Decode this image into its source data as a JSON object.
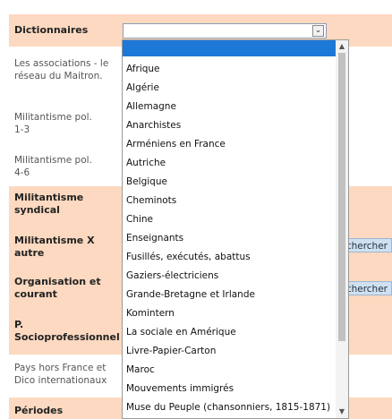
{
  "left_panel": {
    "rows": [
      {
        "label": "Dictionnaires",
        "style": "peach-bold"
      },
      {
        "label": "Les associations - le réseau du Maitron.",
        "style": "light"
      },
      {
        "label": "Militantisme pol. 1-3",
        "style": "light"
      },
      {
        "label": "Militantisme pol. 4-6",
        "style": "light"
      },
      {
        "label": "Militantisme syndical",
        "style": "peach-bold"
      },
      {
        "label": "Militantisme X autre",
        "style": "peach-bold"
      },
      {
        "label": "Organisation et courant",
        "style": "peach-bold"
      },
      {
        "label": "P. Socioprofessionnel",
        "style": "peach-bold"
      },
      {
        "label": "Pays hors France et Dico internationaux",
        "style": "light"
      },
      {
        "label": "Périodes",
        "style": "peach-bold"
      }
    ]
  },
  "search_buttons": [
    "chercher",
    "chercher"
  ],
  "select": {
    "value": ""
  },
  "dropdown_options": [
    "",
    "Afrique",
    "Algérie",
    "Allemagne",
    "Anarchistes",
    "Arméniens en France",
    "Autriche",
    "Belgique",
    "Cheminots",
    "Chine",
    "Enseignants",
    "Fusillés, exécutés, abattus",
    "Gaziers-électriciens",
    "Grande-Bretagne et Irlande",
    "Komintern",
    "La sociale en Amérique",
    "Livre-Papier-Carton",
    "Maroc",
    "Mouvements immigrés",
    "Muse du Peuple (chansonniers, 1815-1871)"
  ],
  "colors": {
    "peach": "#fcd9c0",
    "highlight": "#1e78d8",
    "button": "#cfe1f1"
  }
}
